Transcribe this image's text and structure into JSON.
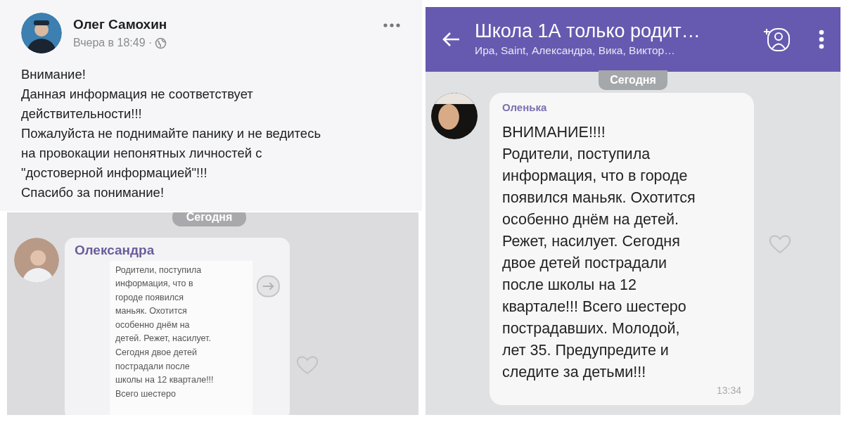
{
  "post": {
    "author": "Олег Самохин",
    "time": "Вчера в 18:49 ·",
    "text": "Внимание!\nДанная информация не соответствует\nдействительности!!!\nПожалуйста не поднимайте панику и не ведитесь\nна провокации непонятных личностей с\n\"достоверной информацией\"!!!\nСпасибо за понимание!"
  },
  "forwarded_chat": {
    "date": "Сегодня",
    "sender": "Олександра",
    "text": "Родители, поступила\nинформация, что в\nгороде появился\nманьяк. Охотится\nособенно днём на\nдетей.  Режет, насилует.\nСегодня двое детей\nпострадали после\nшколы на 12 квартале!!!\nВсего шестеро"
  },
  "chat": {
    "title": "Школа 1А только родит…",
    "members": "Ира, Saint, Александра, Вика, Виктор…",
    "date": "Сегодня",
    "sender": "Оленька",
    "text": "ВНИМАНИЕ!!!!\nРодители, поступила\nинформация, что в городе\nпоявился маньяк. Охотится\nособенно днём на детей.\nРежет, насилует. Сегодня\nдвое детей пострадали\nпосле школы на 12\nквартале!!! Всего шестеро\nпострадавших. Молодой,\nлет 35. Предупредите и\nследите за детьми!!!",
    "time": "13:34"
  }
}
